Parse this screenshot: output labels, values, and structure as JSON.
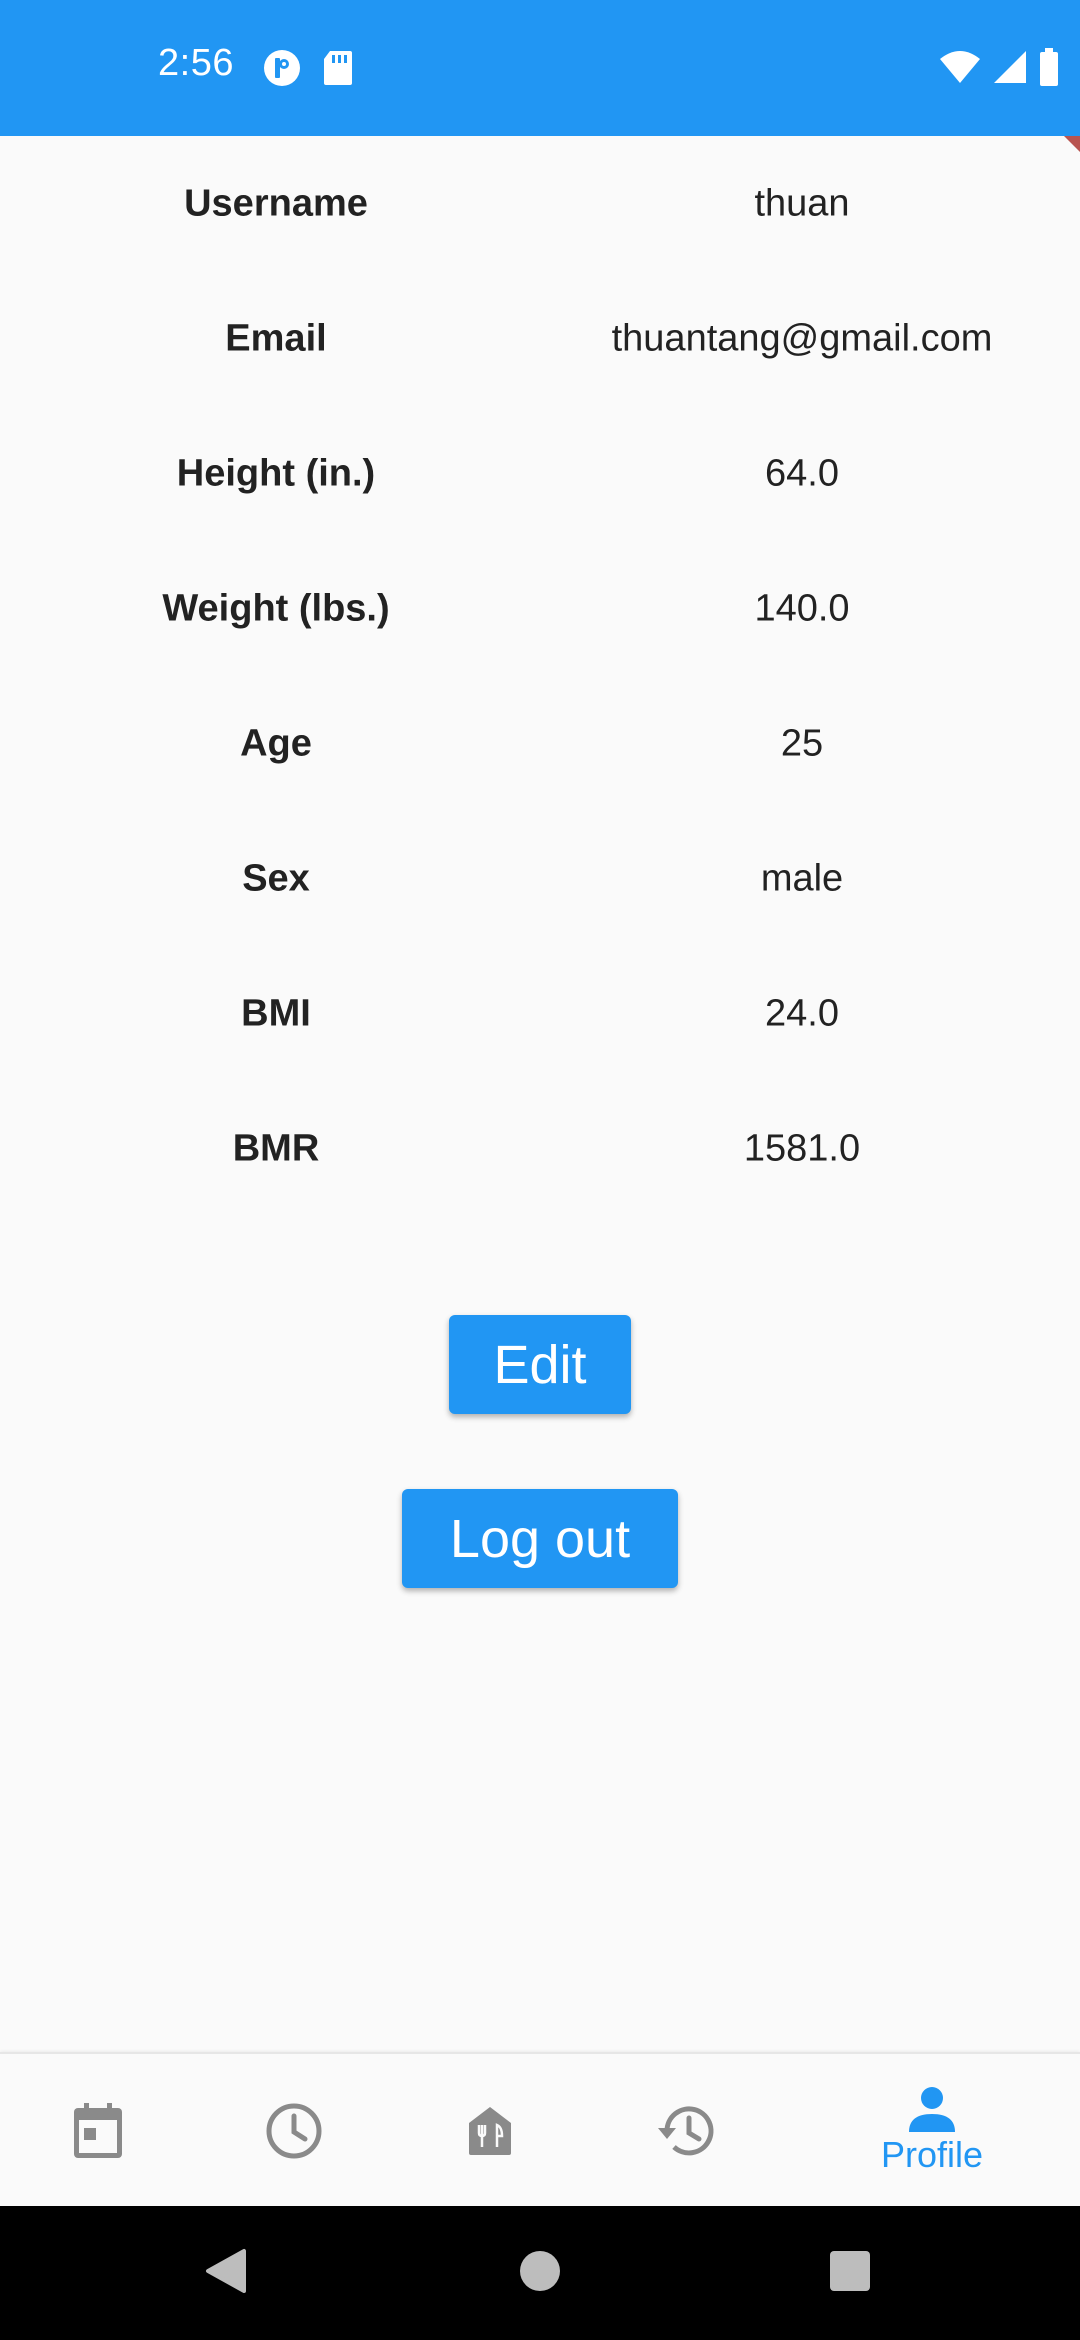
{
  "status_bar": {
    "time": "2:56",
    "icons_left": [
      "notification-p-icon",
      "sd-card-icon"
    ],
    "icons_right": [
      "wifi-icon",
      "cell-signal-icon",
      "battery-icon"
    ],
    "color": "#2196f3"
  },
  "profile": {
    "rows": [
      {
        "label": "Username",
        "value": "thuan"
      },
      {
        "label": "Email",
        "value": "thuantang@gmail.com"
      },
      {
        "label": "Height (in.)",
        "value": "64.0"
      },
      {
        "label": "Weight (lbs.)",
        "value": "140.0"
      },
      {
        "label": "Age",
        "value": "25"
      },
      {
        "label": "Sex",
        "value": "male"
      },
      {
        "label": "BMI",
        "value": "24.0"
      },
      {
        "label": "BMR",
        "value": "1581.0"
      }
    ]
  },
  "buttons": {
    "edit_label": "Edit",
    "logout_label": "Log out"
  },
  "bottom_nav": {
    "items": [
      {
        "icon": "calendar-icon",
        "label": ""
      },
      {
        "icon": "clock-icon",
        "label": ""
      },
      {
        "icon": "restaurant-icon",
        "label": ""
      },
      {
        "icon": "history-icon",
        "label": ""
      },
      {
        "icon": "person-icon",
        "label": "Profile",
        "active": true
      }
    ],
    "active_color": "#2196f3",
    "inactive_color": "#8a8a8a"
  },
  "system_nav": {
    "buttons": [
      "back-icon",
      "home-icon",
      "recents-icon"
    ]
  }
}
